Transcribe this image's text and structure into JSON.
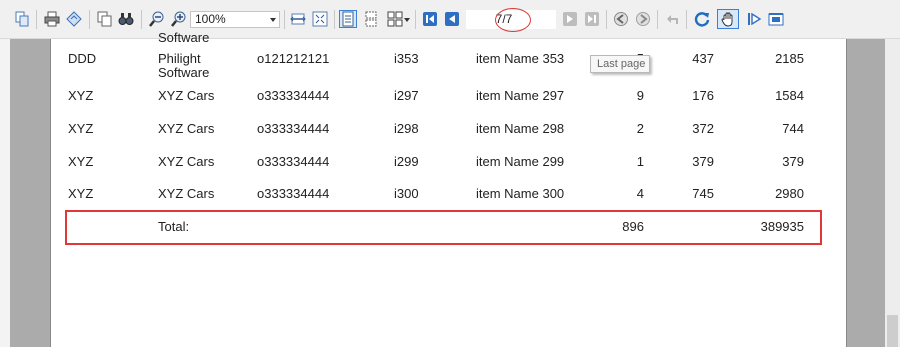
{
  "toolbar": {
    "zoom_value": "100%",
    "page_indicator": "7/7",
    "icons": [
      "copy-page-icon",
      "print-icon",
      "page-setup-icon",
      "copy-icon",
      "find-icon",
      "zoom-out-icon",
      "zoom-in-icon",
      "page-width-icon",
      "whole-page-icon",
      "single-page-icon",
      "continuous-icon",
      "multipage-icon",
      "first-page-icon",
      "previous-page-icon",
      "next-page-icon",
      "last-page-icon",
      "back-icon",
      "forward-icon",
      "stop-icon",
      "refresh-icon",
      "hand-tool-icon",
      "play-icon",
      "export-icon"
    ]
  },
  "tooltip": "Last page",
  "report": {
    "partial_top_text": "Software",
    "rows": [
      {
        "c1": "DDD",
        "c2a": "Philight",
        "c2b": "Software",
        "c3": "o121212121",
        "c4": "i353",
        "c5": "item Name 353",
        "c6": "5",
        "c7": "437",
        "c8": "2185"
      },
      {
        "c1": "XYZ",
        "c2a": "XYZ Cars",
        "c2b": "",
        "c3": "o333334444",
        "c4": "i297",
        "c5": "item Name 297",
        "c6": "9",
        "c7": "176",
        "c8": "1584"
      },
      {
        "c1": "XYZ",
        "c2a": "XYZ Cars",
        "c2b": "",
        "c3": "o333334444",
        "c4": "i298",
        "c5": "item Name 298",
        "c6": "2",
        "c7": "372",
        "c8": "744"
      },
      {
        "c1": "XYZ",
        "c2a": "XYZ Cars",
        "c2b": "",
        "c3": "o333334444",
        "c4": "i299",
        "c5": "item Name 299",
        "c6": "1",
        "c7": "379",
        "c8": "379"
      },
      {
        "c1": "XYZ",
        "c2a": "XYZ Cars",
        "c2b": "",
        "c3": "o333334444",
        "c4": "i300",
        "c5": "item Name 300",
        "c6": "4",
        "c7": "745",
        "c8": "2980"
      }
    ],
    "total": {
      "label": "Total:",
      "qty": "896",
      "amount": "389935"
    }
  },
  "colors": {
    "highlight_red": "#e03838",
    "toolbar_bg": "#f0f0f0",
    "active_blue": "#3b7fd6"
  }
}
